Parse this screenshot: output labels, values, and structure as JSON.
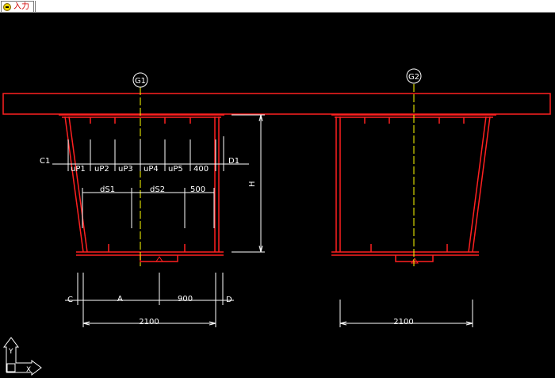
{
  "tab": {
    "label": "入力",
    "icon": "input-mode-icon"
  },
  "colors": {
    "background": "#000000",
    "structure": "#ff2020",
    "centerline": "#ffff00",
    "dimension": "#ffffff"
  },
  "drawing": {
    "girder1": {
      "label": "G1"
    },
    "girder2": {
      "label": "G2"
    },
    "dims": {
      "C1": "C1",
      "uP1": "uP1",
      "uP2": "uP2",
      "uP3": "uP3",
      "uP4": "uP4",
      "uP5": "uP5",
      "top_right": "400",
      "D1": "D1",
      "dS1": "dS1",
      "dS2": "dS2",
      "bottom_right": "500",
      "H": "H",
      "C": "C",
      "A": "A",
      "span_right": "900",
      "D": "D",
      "width_g1": "2100",
      "width_g2": "2100"
    },
    "axes": {
      "x": "X",
      "y": "Y"
    }
  }
}
